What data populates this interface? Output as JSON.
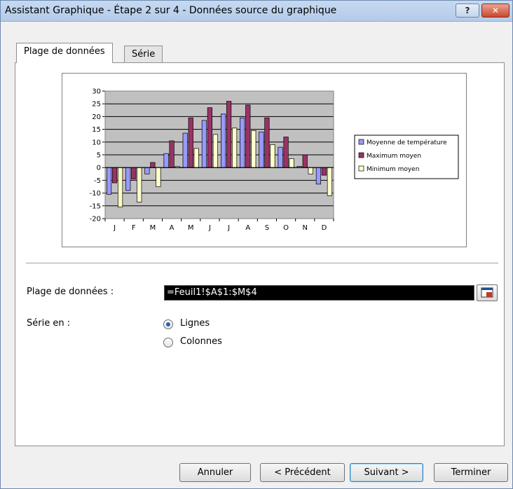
{
  "window": {
    "title": "Assistant Graphique - Étape 2 sur 4 - Données source du graphique"
  },
  "tabs": [
    {
      "label": "Plage de données",
      "active": true
    },
    {
      "label": "Série",
      "active": false
    }
  ],
  "form": {
    "range_label": "Plage de données :",
    "range_value": "=Feuil1!$A$1:$M$4",
    "series_label": "Série en :",
    "options": [
      {
        "label": "Lignes",
        "selected": true
      },
      {
        "label": "Colonnes",
        "selected": false
      }
    ]
  },
  "buttons": {
    "cancel": "Annuler",
    "previous": "< Précédent",
    "next": "Suivant >",
    "finish": "Terminer"
  },
  "colors": {
    "series": [
      "#9999ff",
      "#993366",
      "#ffffcc"
    ],
    "plot_bg": "#c0c0c0"
  },
  "chart_data": {
    "type": "bar",
    "categories": [
      "J",
      "F",
      "M",
      "A",
      "M",
      "J",
      "J",
      "A",
      "S",
      "O",
      "N",
      "D"
    ],
    "series": [
      {
        "name": "Moyenne de température",
        "values": [
          -10.5,
          -9,
          -2.5,
          5.5,
          13.5,
          18.5,
          21,
          19.5,
          14,
          8,
          0.5,
          -6.5
        ]
      },
      {
        "name": "Maximum moyen",
        "values": [
          -6,
          -4.5,
          2,
          10.5,
          19.5,
          23.5,
          26,
          24.5,
          19.5,
          12,
          5,
          -3
        ]
      },
      {
        "name": "Minimum moyen",
        "values": [
          -15.5,
          -13.5,
          -7.5,
          0.5,
          7.5,
          13,
          15.5,
          14.5,
          9,
          3.5,
          -2.5,
          -11
        ]
      }
    ],
    "ylim": [
      -20,
      30
    ],
    "yticks": [
      "30",
      "25",
      "20",
      "15",
      "10",
      "5",
      "0",
      "-5",
      "-10",
      "-15",
      "-20"
    ],
    "grid": true,
    "legend": "right"
  }
}
